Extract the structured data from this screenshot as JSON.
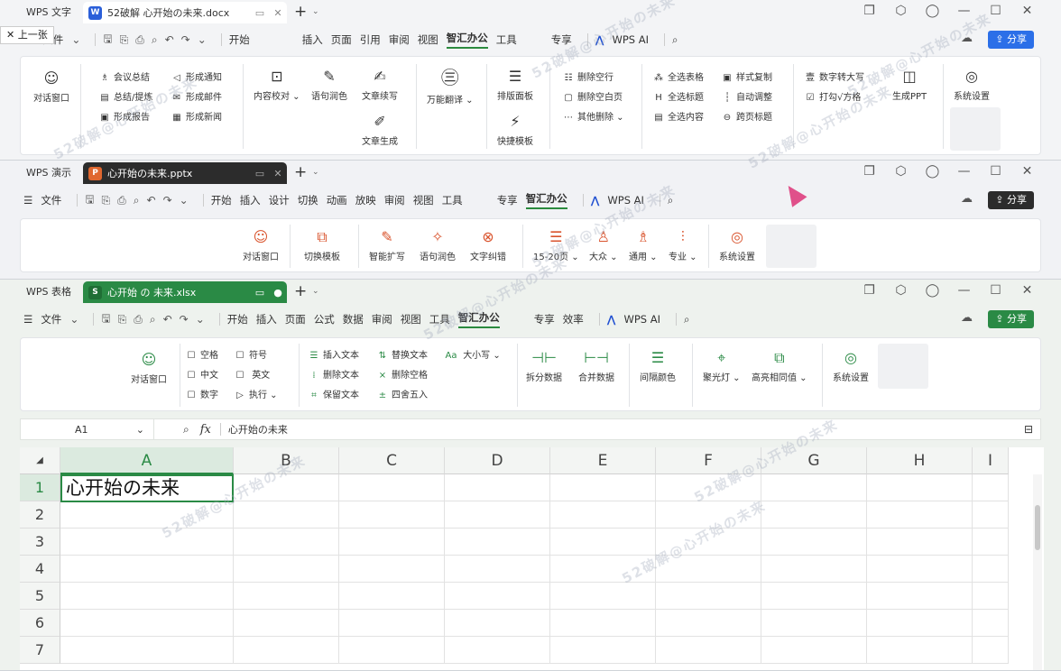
{
  "writer": {
    "app_tag": "WPS 文字",
    "tab_title": "52破解 心开始の未来.docx",
    "menu_file": "文件",
    "tabs": [
      "开始",
      "插入",
      "页面",
      "引用",
      "审阅",
      "视图",
      "智汇办公",
      "工具",
      "专享"
    ],
    "active_tab": "智汇办公",
    "ai_label": "WPS AI",
    "share_label": "分享",
    "ribbon": {
      "chat": "对话窗口",
      "items_col1": [
        "会议总结",
        "总结/提炼",
        "形成报告"
      ],
      "items_col2": [
        "形成通知",
        "形成邮件",
        "形成新闻"
      ],
      "proofread": "内容校对",
      "polish": "语句润色",
      "continue_write": "文章续写",
      "gen_article": "文章生成",
      "translate": "万能翻译",
      "layout_panel": "排版面板",
      "quick_tpl": "快捷模板",
      "del_items": [
        "删除空行",
        "删除空白页",
        "其他删除"
      ],
      "select_items": [
        "全选表格",
        "全选标题",
        "全选内容"
      ],
      "style_items": [
        "样式复制",
        "自动调整",
        "跨页标题"
      ],
      "num_items": [
        "数字转大写",
        "打勾√方格"
      ],
      "gen_ppt": "生成PPT",
      "settings": "系统设置"
    }
  },
  "presentation": {
    "app_tag": "WPS 演示",
    "tab_title": "心开始の未来.pptx",
    "menu_file": "文件",
    "tabs": [
      "开始",
      "插入",
      "设计",
      "切换",
      "动画",
      "放映",
      "审阅",
      "视图",
      "工具",
      "专享",
      "智汇办公"
    ],
    "active_tab": "智汇办公",
    "ai_label": "WPS AI",
    "share_label": "分享",
    "ribbon": [
      "对话窗口",
      "切换模板",
      "智能扩写",
      "语句润色",
      "文字纠错",
      "15-20页",
      "大众",
      "通用",
      "专业",
      "系统设置"
    ]
  },
  "spreadsheet": {
    "app_tag": "WPS 表格",
    "tab_title": "心开始 の 未来.xlsx",
    "menu_file": "文件",
    "tabs": [
      "开始",
      "插入",
      "页面",
      "公式",
      "数据",
      "审阅",
      "视图",
      "工具",
      "智汇办公",
      "专享",
      "效率"
    ],
    "active_tab": "智汇办公",
    "ai_label": "WPS AI",
    "share_label": "分享",
    "ribbon": {
      "chat": "对话窗口",
      "checks": [
        "空格",
        "符号",
        "中文",
        "英文",
        "数字"
      ],
      "execute": "执行",
      "text_ops": [
        "插入文本",
        "删除文本",
        "保留文本"
      ],
      "replace_ops": [
        "替换文本",
        "删除空格",
        "四舍五入"
      ],
      "case": "大小写",
      "split": "拆分数据",
      "merge": "合并数据",
      "interval_color": "间隔颜色",
      "spotlight": "聚光灯",
      "highlight_same": "高亮相同值",
      "settings": "系统设置"
    },
    "name_box": "A1",
    "formula": "心开始の未来",
    "columns": [
      "A",
      "B",
      "C",
      "D",
      "E",
      "F",
      "G",
      "H",
      "I"
    ],
    "rows": [
      "1",
      "2",
      "3",
      "4",
      "5",
      "6",
      "7"
    ],
    "cell_a1": "心开始の未来"
  },
  "prev_label": "上一张",
  "watermark": "52破解@心开始の未来",
  "colors": {
    "writer": "#2b5fd9",
    "presentation": "#c8461f",
    "spreadsheet": "#2a8a45",
    "accent": "#2b8a3e"
  }
}
